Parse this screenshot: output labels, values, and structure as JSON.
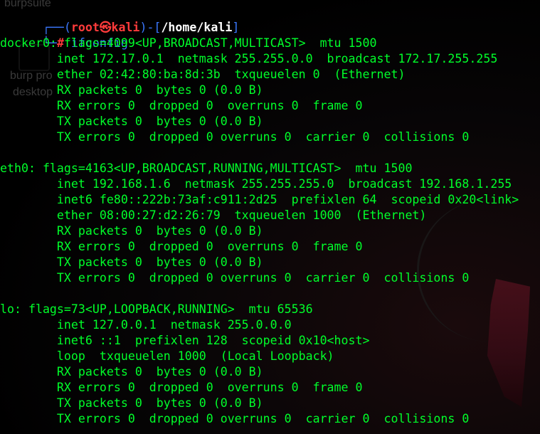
{
  "background": {
    "desktop_labels": [
      "burpsuite",
      "burp pro",
      "desktop"
    ]
  },
  "prompt": {
    "frame_top": "┌──(",
    "user": "root",
    "skull": "㉿",
    "host": "kali",
    "frame_mid": ")-[",
    "path": "/home/kali",
    "frame_close": "]",
    "frame_bottom": "└─",
    "symbol": "#",
    "command": "ifconfig"
  },
  "output_lines": [
    "docker0: flags=4099<UP,BROADCAST,MULTICAST>  mtu 1500",
    "        inet 172.17.0.1  netmask 255.255.0.0  broadcast 172.17.255.255",
    "        ether 02:42:80:ba:8d:3b  txqueuelen 0  (Ethernet)",
    "        RX packets 0  bytes 0 (0.0 B)",
    "        RX errors 0  dropped 0  overruns 0  frame 0",
    "        TX packets 0  bytes 0 (0.0 B)",
    "        TX errors 0  dropped 0 overruns 0  carrier 0  collisions 0",
    "",
    "eth0: flags=4163<UP,BROADCAST,RUNNING,MULTICAST>  mtu 1500",
    "        inet 192.168.1.6  netmask 255.255.255.0  broadcast 192.168.1.255",
    "        inet6 fe80::222b:73af:c911:2d25  prefixlen 64  scopeid 0x20<link>",
    "        ether 08:00:27:d2:26:79  txqueuelen 1000  (Ethernet)",
    "        RX packets 0  bytes 0 (0.0 B)",
    "        RX errors 0  dropped 0  overruns 0  frame 0",
    "        TX packets 0  bytes 0 (0.0 B)",
    "        TX errors 0  dropped 0 overruns 0  carrier 0  collisions 0",
    "",
    "lo: flags=73<UP,LOOPBACK,RUNNING>  mtu 65536",
    "        inet 127.0.0.1  netmask 255.0.0.0",
    "        inet6 ::1  prefixlen 128  scopeid 0x10<host>",
    "        loop  txqueuelen 1000  (Local Loopback)",
    "        RX packets 0  bytes 0 (0.0 B)",
    "        RX errors 0  dropped 0  overruns 0  frame 0",
    "        TX packets 0  bytes 0 (0.0 B)",
    "        TX errors 0  dropped 0 overruns 0  carrier 0  collisions 0"
  ],
  "colors": {
    "output_text": "#00ff2a",
    "prompt_frame": "#3b78ff",
    "prompt_user": "#ff3b3b",
    "prompt_path": "#ffffff",
    "background": "#000000"
  }
}
